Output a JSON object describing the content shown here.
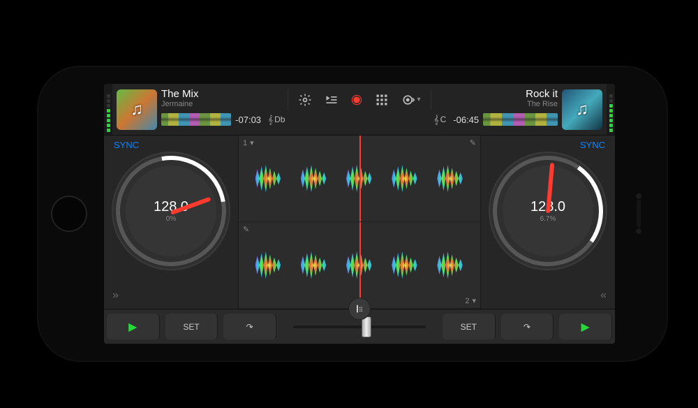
{
  "deckA": {
    "title": "The Mix",
    "artist": "Jermaine",
    "time": "-07:03",
    "key": "Db",
    "bpm": "128.0",
    "pitch": "0%",
    "sync": "SYNC",
    "rowLabel": "1"
  },
  "deckB": {
    "title": "Rock it",
    "artist": "The Rise",
    "time": "-06:45",
    "key": "C",
    "bpm": "128.0",
    "pitch": "6.7%",
    "sync": "SYNC",
    "rowLabel": "2"
  },
  "centerIcons": {
    "settings": "gear",
    "queue": "queue",
    "record": "record",
    "grid": "grid",
    "automix": "automix"
  },
  "bottom": {
    "play": "▶",
    "set": "SET",
    "loop": "↷",
    "expandL": "»",
    "expandR": "«"
  },
  "clef": "𝄞"
}
